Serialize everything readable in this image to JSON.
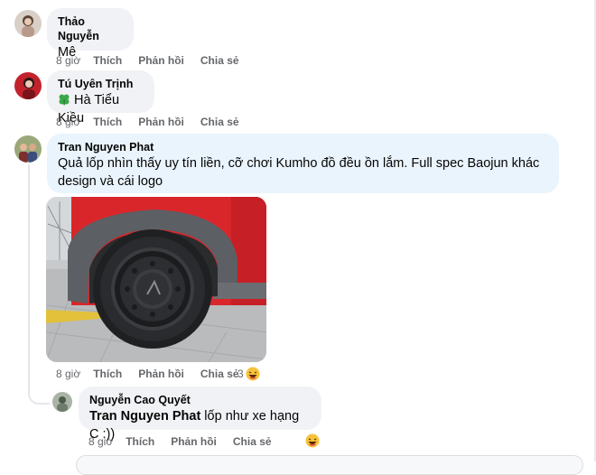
{
  "comments": [
    {
      "author": "Thảo Nguyễn",
      "text": "Mê",
      "time": "8 giờ",
      "like": "Thích",
      "reply": "Phản hồi",
      "share": "Chia sẻ"
    },
    {
      "author": "Tú Uyên Trịnh",
      "text": "Hà Tiểu Kiều",
      "time": "8 giờ",
      "like": "Thích",
      "reply": "Phản hồi",
      "share": "Chia sẻ"
    },
    {
      "author": "Tran Nguyen Phat",
      "text_line1": "Quả lốp nhìn thấy uy tín liền, cỡ chơi Kumho đồ đều ồn lắm. Full spec Baojun khác",
      "text_line2": "design và cái logo",
      "time": "8 giờ",
      "like": "Thích",
      "reply": "Phản hồi",
      "share": "Chia sẻ",
      "reaction_count": "3"
    },
    {
      "author": "Nguyễn Cao Quyết",
      "mention": "Tran Nguyen Phat",
      "text": " lốp như xe hạng C :))",
      "time": "8 giờ",
      "like": "Thích",
      "reply": "Phản hồi",
      "share": "Chia sẻ"
    }
  ],
  "icons": {
    "clover": "four-leaf-clover-icon",
    "reaction": "laughing-emoji-icon"
  },
  "colors": {
    "bubble": "#f0f2f5",
    "bubble_highlight": "#eaf4fc",
    "meta_text": "#65676b",
    "car_red": "#d9262b"
  }
}
